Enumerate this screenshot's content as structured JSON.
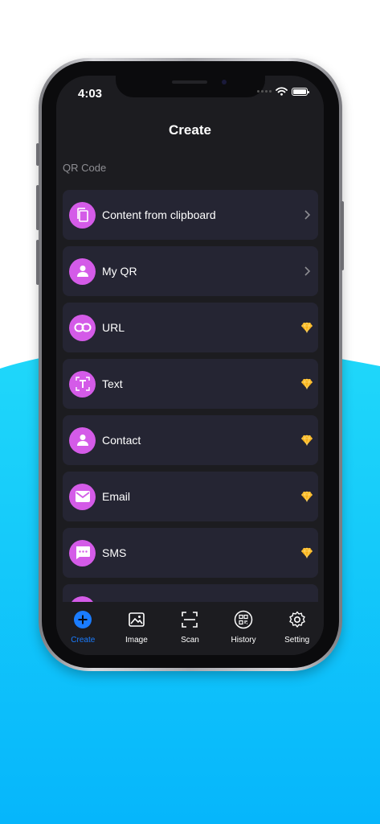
{
  "colors": {
    "accent": "#1a7cff",
    "avatar": "#d45be8",
    "background_wave": "#19cff8",
    "screen": "#1c1c20",
    "row": "#252533",
    "gem": "#f7b21a"
  },
  "status_bar": {
    "time": "4:03"
  },
  "header": {
    "title": "Create"
  },
  "section": {
    "title": "QR Code"
  },
  "items": [
    {
      "label": "Content from clipboard",
      "icon": "clipboard-copy-icon",
      "trailing": "chevron"
    },
    {
      "label": "My QR",
      "icon": "person-icon",
      "trailing": "chevron"
    },
    {
      "label": "URL",
      "icon": "link-icon",
      "trailing": "premium-gem"
    },
    {
      "label": "Text",
      "icon": "text-icon",
      "trailing": "premium-gem"
    },
    {
      "label": "Contact",
      "icon": "person-icon",
      "trailing": "premium-gem"
    },
    {
      "label": "Email",
      "icon": "mail-icon",
      "trailing": "premium-gem"
    },
    {
      "label": "SMS",
      "icon": "message-icon",
      "trailing": "premium-gem"
    }
  ],
  "tabs": [
    {
      "label": "Create",
      "icon": "plus-circle-icon",
      "active": true
    },
    {
      "label": "Image",
      "icon": "image-icon",
      "active": false
    },
    {
      "label": "Scan",
      "icon": "scan-icon",
      "active": false
    },
    {
      "label": "History",
      "icon": "qr-history-icon",
      "active": false
    },
    {
      "label": "Setting",
      "icon": "gear-icon",
      "active": false
    }
  ]
}
